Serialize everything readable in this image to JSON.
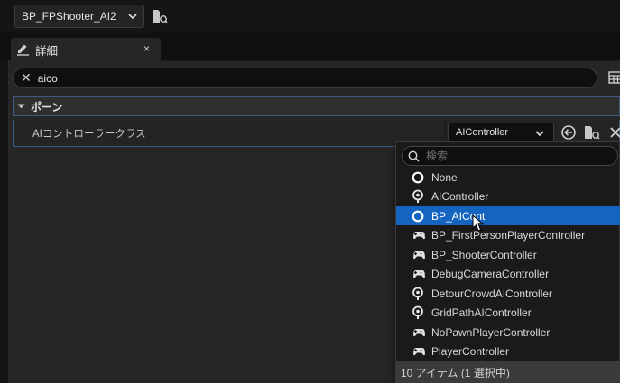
{
  "toolbar": {
    "blueprint_name": "BP_FPShooter_AI2",
    "icons": {
      "dropdown": "chevron-down-icon",
      "browse": "browse-folder-icon"
    }
  },
  "details_tab": {
    "label": "詳細",
    "close": "×",
    "icon": "details-pencil-icon"
  },
  "search": {
    "value": "aico",
    "clear": "✕"
  },
  "category": {
    "label": "ポーン"
  },
  "property": {
    "label": "AIコントローラークラス",
    "value": "AIController",
    "icons": [
      "use-selected-arrow-icon",
      "browse-folder-icon",
      "clear-icon"
    ]
  },
  "picker": {
    "search_placeholder": "検索",
    "options": [
      {
        "label": "None",
        "icon": "none-circle-icon",
        "selected": false
      },
      {
        "label": "AIController",
        "icon": "ai-controller-icon",
        "selected": false
      },
      {
        "label": "BP_AICont",
        "icon": "none-circle-icon",
        "selected": true
      },
      {
        "label": "BP_FirstPersonPlayerController",
        "icon": "gamepad-icon",
        "selected": false
      },
      {
        "label": "BP_ShooterController",
        "icon": "gamepad-icon",
        "selected": false
      },
      {
        "label": "DebugCameraController",
        "icon": "gamepad-icon",
        "selected": false
      },
      {
        "label": "DetourCrowdAIController",
        "icon": "ai-controller-icon",
        "selected": false
      },
      {
        "label": "GridPathAIController",
        "icon": "ai-controller-icon",
        "selected": false
      },
      {
        "label": "NoPawnPlayerController",
        "icon": "gamepad-icon",
        "selected": false
      },
      {
        "label": "PlayerController",
        "icon": "gamepad-icon",
        "selected": false
      }
    ],
    "footer": "10 アイテム (1 選択中)"
  },
  "colors": {
    "selection": "#1565c0",
    "row_outline": "#3b5a86",
    "panel": "#262626"
  }
}
